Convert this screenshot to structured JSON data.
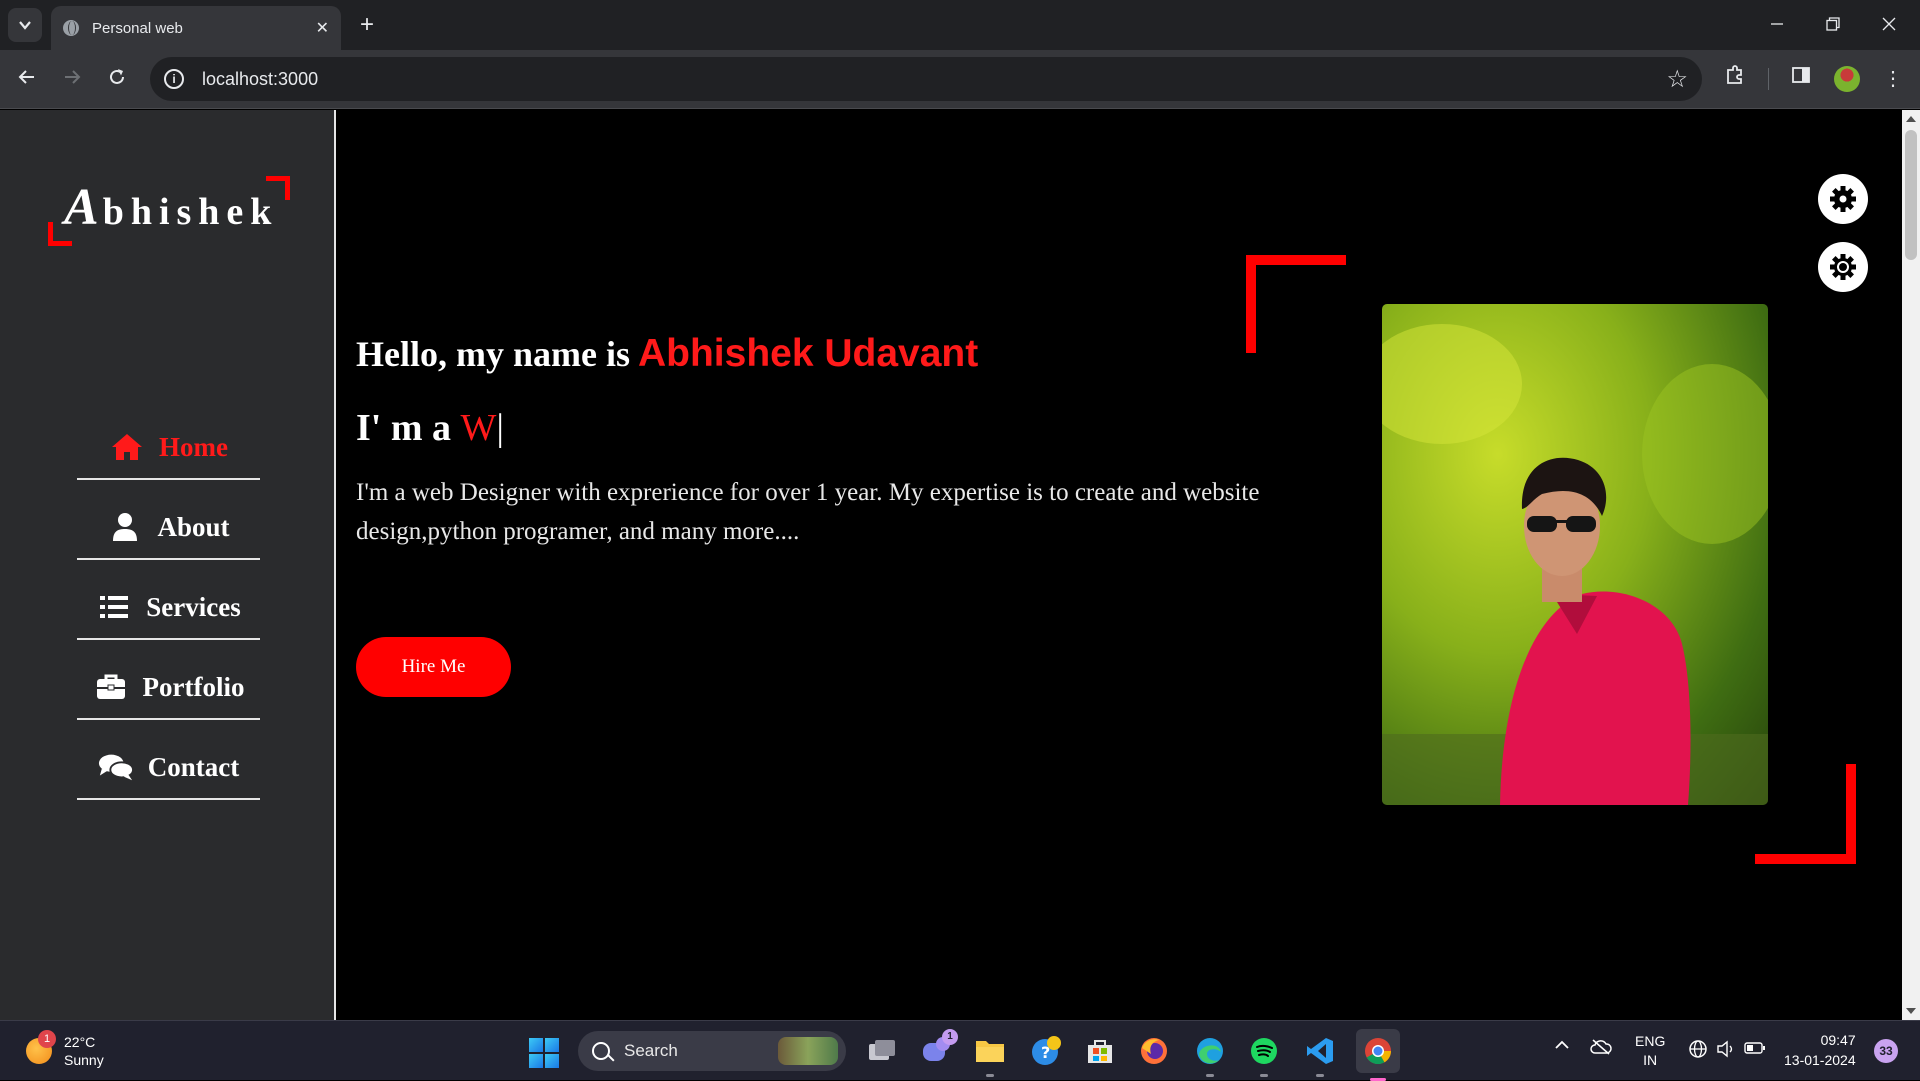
{
  "browser": {
    "tab_title": "Personal web",
    "url": "localhost:3000",
    "new_tab_label": "+",
    "close_tab_label": "✕"
  },
  "sidebar": {
    "logo_first": "A",
    "logo_rest": "bhishek",
    "nav": [
      {
        "label": "Home",
        "icon": "home-icon",
        "active": true
      },
      {
        "label": "About",
        "icon": "user-icon",
        "active": false
      },
      {
        "label": "Services",
        "icon": "list-icon",
        "active": false
      },
      {
        "label": "Portfolio",
        "icon": "briefcase-icon",
        "active": false
      },
      {
        "label": "Contact",
        "icon": "comments-icon",
        "active": false
      }
    ]
  },
  "hero": {
    "greeting": "Hello, my name is",
    "name": "Abhishek Udavant",
    "role_prefix": "I' m a",
    "role_typed": "W",
    "cursor": "|",
    "description": "I'm a web Designer with exprerience for over 1 year. My expertise is to create and website design,python programer, and many more....",
    "hire_button": "Hire Me"
  },
  "colors": {
    "accent": "#ff0000",
    "sidebar_bg": "#2a2b2d",
    "page_bg": "#000000"
  },
  "taskbar": {
    "weather_temp": "22°C",
    "weather_desc": "Sunny",
    "weather_badge": "1",
    "search_label": "Search",
    "teams_badge": "1",
    "lang_line1": "ENG",
    "lang_line2": "IN",
    "time": "09:47",
    "date": "13-01-2024",
    "notification_count": "33"
  }
}
